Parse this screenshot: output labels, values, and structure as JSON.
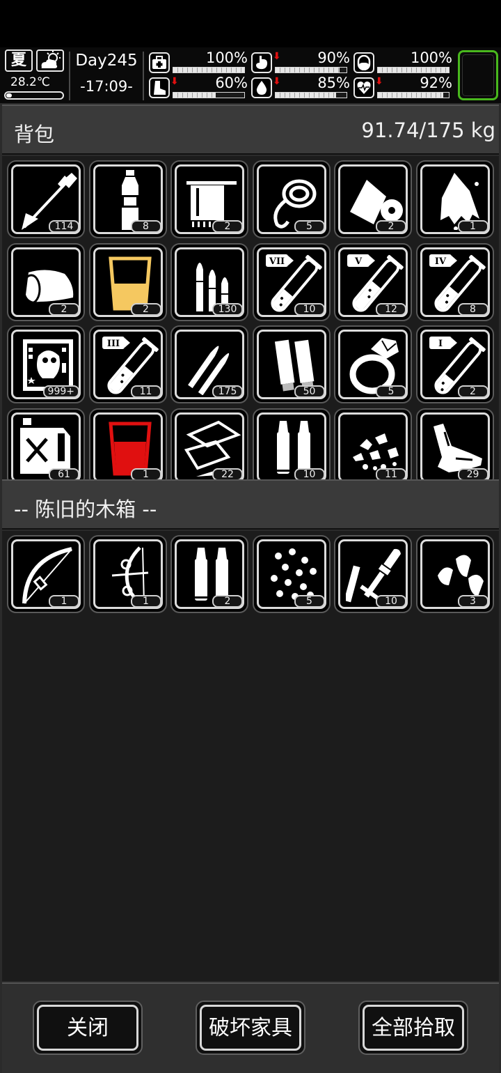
{
  "status": {
    "season": "夏",
    "weather_icon": "partly-cloudy-icon",
    "temperature": "28.2℃",
    "day": "Day245",
    "time": "-17:09-",
    "stats": [
      {
        "key": "health",
        "icon": "medkit-icon",
        "value": "100%",
        "fraction": 1.0,
        "decreasing": false
      },
      {
        "key": "hunger",
        "icon": "stomach-icon",
        "value": "90%",
        "fraction": 0.9,
        "decreasing": true
      },
      {
        "key": "medicine",
        "icon": "pill-icon",
        "value": "100%",
        "fraction": 1.0,
        "decreasing": false
      },
      {
        "key": "stamina",
        "icon": "boot-icon",
        "value": "60%",
        "fraction": 0.6,
        "decreasing": true
      },
      {
        "key": "thirst",
        "icon": "water-drop-icon",
        "value": "85%",
        "fraction": 0.85,
        "decreasing": true
      },
      {
        "key": "mood",
        "icon": "heart-icon",
        "value": "92%",
        "fraction": 0.92,
        "decreasing": true
      }
    ],
    "accent_color": "#49b81d",
    "warning_color": "#e01010"
  },
  "backpack": {
    "title": "背包",
    "weight": "91.74/175 kg",
    "items": [
      {
        "icon": "arrow-icon",
        "count": "114"
      },
      {
        "icon": "water-bottle-icon",
        "count": "8"
      },
      {
        "icon": "towel-icon",
        "count": "2"
      },
      {
        "icon": "rope-icon",
        "count": "5"
      },
      {
        "icon": "bandage-roll-icon",
        "count": "2"
      },
      {
        "icon": "torn-cloth-icon",
        "count": "1"
      },
      {
        "icon": "cloth-roll-icon",
        "count": "2"
      },
      {
        "icon": "glass-of-juice-icon",
        "count": "2"
      },
      {
        "icon": "rifle-bullets-icon",
        "count": "130"
      },
      {
        "icon": "test-tube-vii-icon",
        "count": "10"
      },
      {
        "icon": "test-tube-v-icon",
        "count": "12"
      },
      {
        "icon": "test-tube-iv-icon",
        "count": "8"
      },
      {
        "icon": "zombie-card-icon",
        "count": "999+"
      },
      {
        "icon": "test-tube-iii-icon",
        "count": "11"
      },
      {
        "icon": "cartridges-icon",
        "count": "175"
      },
      {
        "icon": "shotgun-shells-icon",
        "count": "50"
      },
      {
        "icon": "ring-icon",
        "count": "5"
      },
      {
        "icon": "test-tube-i-icon",
        "count": "2"
      },
      {
        "icon": "fuel-can-icon",
        "count": "61"
      },
      {
        "icon": "glass-of-blood-icon",
        "count": "1"
      },
      {
        "icon": "paper-scraps-icon",
        "count": "22"
      },
      {
        "icon": "shell-casings-icon",
        "count": "10"
      },
      {
        "icon": "rubble-icon",
        "count": "11"
      },
      {
        "icon": "animal-hide-icon",
        "count": "29"
      }
    ]
  },
  "container": {
    "title": "-- 陈旧的木箱 --",
    "items": [
      {
        "icon": "bow-icon",
        "count": "1"
      },
      {
        "icon": "compound-bow-icon",
        "count": "1"
      },
      {
        "icon": "shell-casings-icon",
        "count": "2"
      },
      {
        "icon": "pellets-icon",
        "count": "5"
      },
      {
        "icon": "rocket-parts-icon",
        "count": "10"
      },
      {
        "icon": "bullet-heads-icon",
        "count": "3"
      }
    ]
  },
  "buttons": {
    "close": "关闭",
    "destroy": "破坏家具",
    "take_all": "全部拾取"
  }
}
